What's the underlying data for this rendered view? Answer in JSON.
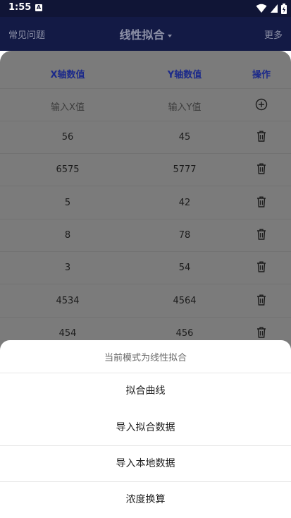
{
  "status_bar": {
    "time": "1:55",
    "notif_letter": "A"
  },
  "app_bar": {
    "left_label": "常见问题",
    "title": "线性拟合",
    "right_label": "更多"
  },
  "table": {
    "header": {
      "x": "X轴数值",
      "y": "Y轴数值",
      "action": "操作"
    },
    "input": {
      "x_placeholder": "输入X值",
      "y_placeholder": "输入Y值"
    },
    "rows": [
      {
        "x": "56",
        "y": "45"
      },
      {
        "x": "6575",
        "y": "5777"
      },
      {
        "x": "5",
        "y": "42"
      },
      {
        "x": "8",
        "y": "78"
      },
      {
        "x": "3",
        "y": "54"
      },
      {
        "x": "4534",
        "y": "4564"
      },
      {
        "x": "454",
        "y": "456"
      }
    ]
  },
  "sheet": {
    "title": "当前模式为线性拟合",
    "items": [
      "拟合曲线",
      "导入拟合数据",
      "导入本地数据",
      "浓度换算"
    ]
  }
}
